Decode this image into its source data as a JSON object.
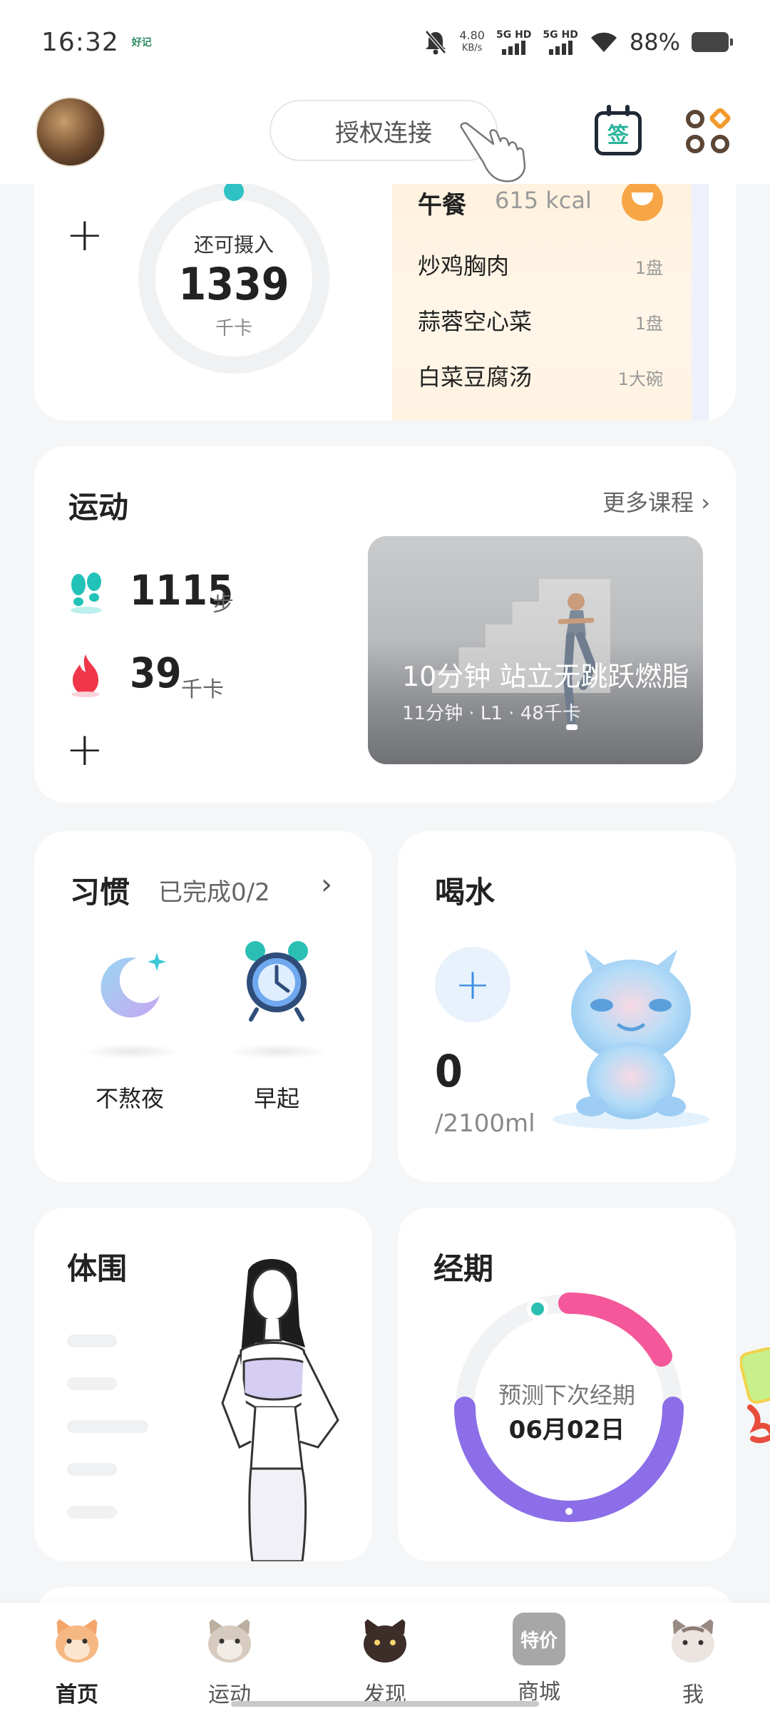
{
  "status_bar": {
    "time": "16:32",
    "app_indicator": "好记",
    "net_speed_value": "4.80",
    "net_speed_unit": "KB/s",
    "sim1": "5G HD",
    "sim2": "5G HD",
    "battery": "88%"
  },
  "header": {
    "auth_button": "授权连接",
    "sign_icon_text": "签"
  },
  "diet": {
    "remaining_label": "还可摄入",
    "remaining_value": "1339",
    "remaining_unit": "千卡",
    "meal_title": "午餐",
    "meal_kcal": "615 kcal",
    "items": [
      {
        "name": "炒鸡胸肉",
        "qty": "1盘"
      },
      {
        "name": "蒜蓉空心菜",
        "qty": "1盘"
      },
      {
        "name": "白菜豆腐汤",
        "qty": "1大碗"
      }
    ]
  },
  "sport": {
    "title": "运动",
    "more": "更多课程",
    "steps": "1115",
    "steps_unit": "步",
    "kcal": "39",
    "kcal_unit": "千卡",
    "course_title": "10分钟 站立无跳跃燃脂",
    "course_meta": "11分钟 · L1 · 48千卡"
  },
  "habit": {
    "title": "习惯",
    "progress": "已完成0/2",
    "items": [
      {
        "label": "不熬夜"
      },
      {
        "label": "早起"
      }
    ]
  },
  "water": {
    "title": "喝水",
    "current": "0",
    "goal": "/2100ml"
  },
  "body": {
    "title": "体围"
  },
  "period": {
    "title": "经期",
    "subtitle": "预测下次经期",
    "date": "06月02日"
  },
  "nav": {
    "items": [
      {
        "label": "首页",
        "icon": "cat-orange-icon"
      },
      {
        "label": "运动",
        "icon": "cat-gray-icon"
      },
      {
        "label": "发现",
        "icon": "cat-black-icon"
      },
      {
        "label": "商城",
        "icon": "special-price-icon",
        "badge": "特价"
      },
      {
        "label": "我",
        "icon": "cat-tabby-icon"
      }
    ]
  },
  "colors": {
    "accent_teal": "#2ab39a",
    "period_pink": "#f4589a",
    "period_purple": "#8b6ee8",
    "water_blue": "#3d8fe4",
    "meal_orange": "#f7a646"
  }
}
